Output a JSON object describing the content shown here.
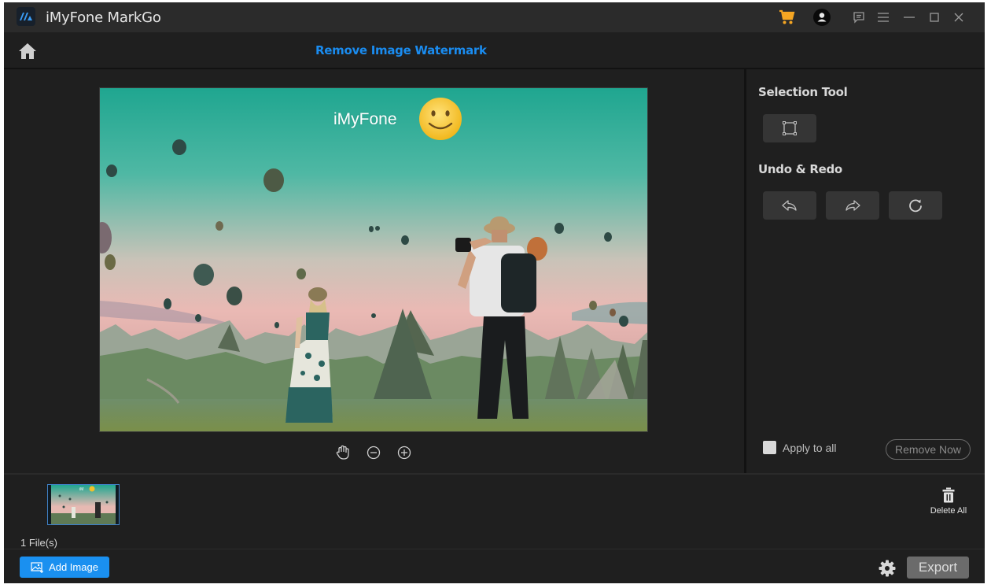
{
  "app": {
    "title": "iMyFone MarkGo",
    "titlebar_icons": [
      "cart-icon",
      "account-icon",
      "feedback-icon",
      "menu-icon",
      "minimize-icon",
      "maximize-icon",
      "close-icon"
    ]
  },
  "header": {
    "home_icon": "home-icon",
    "page_title": "Remove Image Watermark"
  },
  "canvas": {
    "image_watermark_text": "iMyFone",
    "image_watermark_emoji": "slightly-smiling-face",
    "tools": [
      {
        "name": "hand-pan",
        "icon": "hand-icon"
      },
      {
        "name": "zoom-out",
        "icon": "zoom-out-icon"
      },
      {
        "name": "zoom-in",
        "icon": "zoom-in-icon"
      }
    ]
  },
  "right_panel": {
    "selection_heading": "Selection Tool",
    "selection_tool_icon": "rectangle-select-icon",
    "undo_heading": "Undo & Redo",
    "undo_icon": "undo-icon",
    "redo_icon": "redo-icon",
    "reset_icon": "refresh-icon",
    "apply_to_all_label": "Apply to all",
    "apply_to_all_checked": false,
    "remove_now_label": "Remove Now"
  },
  "files": {
    "count_label": "1 File(s)",
    "delete_all_label": "Delete All"
  },
  "footer": {
    "add_image_label": "Add Image",
    "export_label": "Export"
  },
  "colors": {
    "accent_blue": "#1a8cf0",
    "cart_orange": "#f5a623",
    "background": "#1f1f1f",
    "titlebar": "#2b2b2b"
  }
}
